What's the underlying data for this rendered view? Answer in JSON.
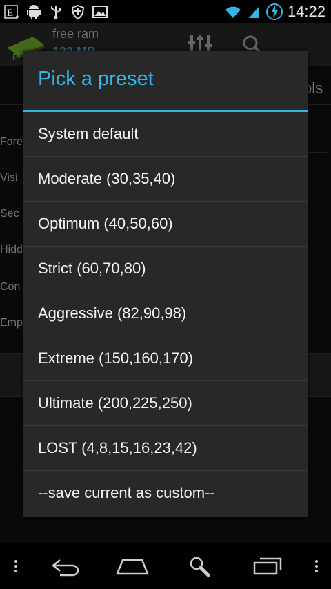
{
  "status_bar": {
    "time": "14:22",
    "left_icons": [
      "E-notification-icon",
      "android-icon",
      "usb-icon",
      "shield-icon",
      "image-icon"
    ],
    "right_icons": [
      "wifi-icon",
      "signal-icon",
      "battery-charging-icon"
    ]
  },
  "app": {
    "title": "free ram",
    "subtitle": "123 MB",
    "tab_right": "ols",
    "bg_labels": [
      "Fore",
      "Visi",
      "Sec",
      "Hidd",
      "Con",
      "Emp"
    ]
  },
  "dialog": {
    "title": "Pick a preset",
    "items": [
      {
        "label": "System default"
      },
      {
        "label": "Moderate (30,35,40)"
      },
      {
        "label": "Optimum (40,50,60)"
      },
      {
        "label": "Strict (60,70,80)"
      },
      {
        "label": "Aggressive (82,90,98)"
      },
      {
        "label": "Extreme (150,160,170)"
      },
      {
        "label": "Ultimate (200,225,250)"
      },
      {
        "label": "LOST (4,8,15,16,23,42)"
      },
      {
        "label": "--save current as custom--"
      }
    ]
  },
  "navbar": {
    "buttons": [
      "menu-icon",
      "back-icon",
      "home-icon",
      "search-icon",
      "recent-apps-icon",
      "menu-icon"
    ]
  },
  "colors": {
    "accent": "#33b5e5",
    "dialog_bg": "#282828",
    "divider": "#3a3a3a"
  }
}
